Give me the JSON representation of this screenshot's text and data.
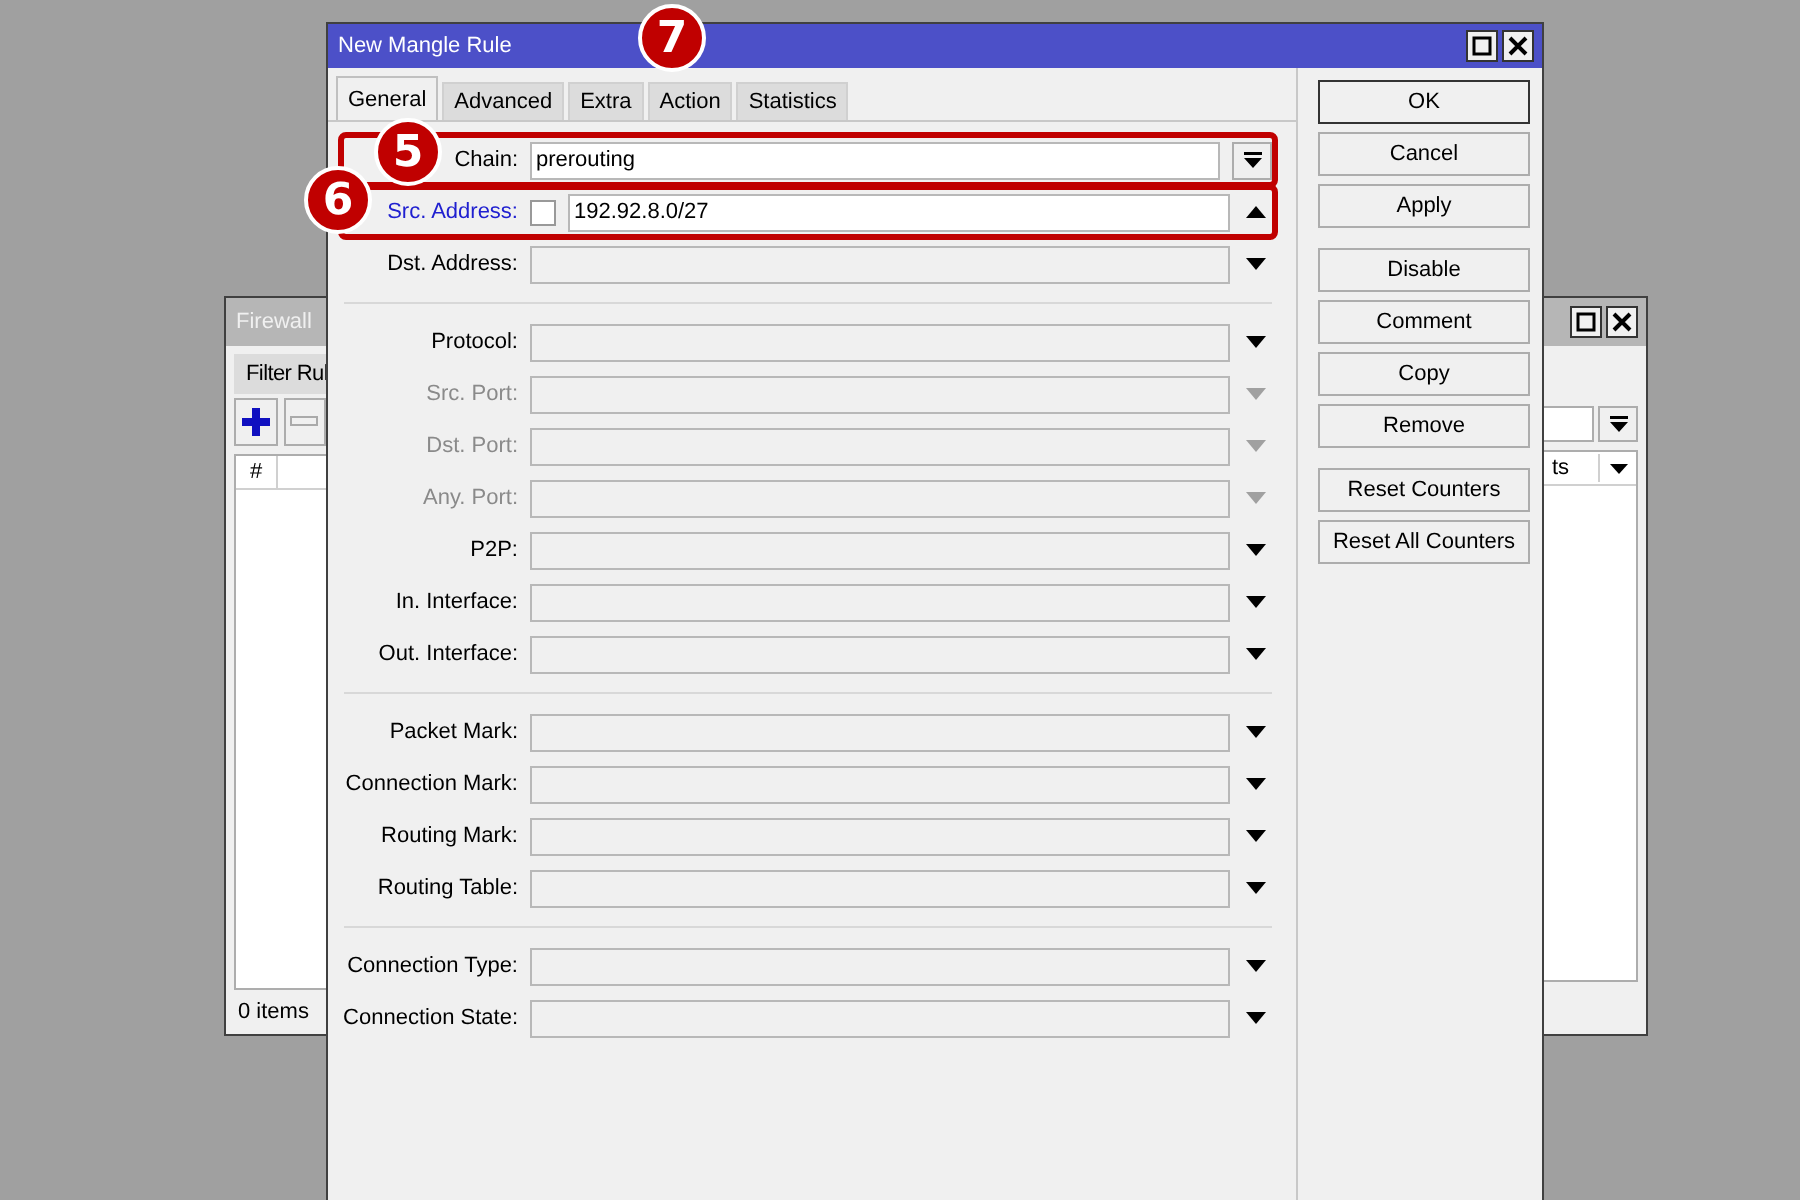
{
  "background_window": {
    "title": "Firewall",
    "tab": "Filter Rul",
    "column_1": "#",
    "column_2": "ts",
    "status": "0 items"
  },
  "dialog": {
    "title": "New Mangle Rule",
    "tabs": [
      {
        "label": "General",
        "selected": true
      },
      {
        "label": "Advanced",
        "selected": false
      },
      {
        "label": "Extra",
        "selected": false
      },
      {
        "label": "Action",
        "selected": false
      },
      {
        "label": "Statistics",
        "selected": false
      }
    ],
    "sections": [
      {
        "rows": [
          {
            "kind": "select",
            "label": "Chain:",
            "value": "prerouting",
            "outlined": true,
            "callout": "5"
          },
          {
            "kind": "address",
            "label": "Src. Address:",
            "value": "192.92.8.0/27",
            "negated": false,
            "expanded": true,
            "outlined": true,
            "callout": "6"
          },
          {
            "kind": "combo",
            "label": "Dst. Address:",
            "disabled": false,
            "expanded": false
          }
        ]
      },
      {
        "rows": [
          {
            "kind": "combo",
            "label": "Protocol:",
            "disabled": false,
            "expanded": false
          },
          {
            "kind": "combo",
            "label": "Src. Port:",
            "disabled": true,
            "expanded": false
          },
          {
            "kind": "combo",
            "label": "Dst. Port:",
            "disabled": true,
            "expanded": false
          },
          {
            "kind": "combo",
            "label": "Any. Port:",
            "disabled": true,
            "expanded": false
          },
          {
            "kind": "combo",
            "label": "P2P:",
            "disabled": false,
            "expanded": false
          },
          {
            "kind": "combo",
            "label": "In. Interface:",
            "disabled": false,
            "expanded": false
          },
          {
            "kind": "combo",
            "label": "Out. Interface:",
            "disabled": false,
            "expanded": false
          }
        ]
      },
      {
        "rows": [
          {
            "kind": "combo",
            "label": "Packet Mark:",
            "disabled": false,
            "expanded": false
          },
          {
            "kind": "combo",
            "label": "Connection Mark:",
            "disabled": false,
            "expanded": false
          },
          {
            "kind": "combo",
            "label": "Routing Mark:",
            "disabled": false,
            "expanded": false
          },
          {
            "kind": "combo",
            "label": "Routing Table:",
            "disabled": false,
            "expanded": false
          }
        ]
      },
      {
        "rows": [
          {
            "kind": "combo",
            "label": "Connection Type:",
            "disabled": false,
            "expanded": false
          },
          {
            "kind": "combo",
            "label": "Connection State:",
            "disabled": false,
            "expanded": false
          }
        ]
      }
    ],
    "button_groups": [
      [
        "OK",
        "Cancel",
        "Apply"
      ],
      [
        "Disable",
        "Comment",
        "Copy",
        "Remove"
      ],
      [
        "Reset Counters",
        "Reset All Counters"
      ]
    ],
    "tab_callout": "7"
  }
}
